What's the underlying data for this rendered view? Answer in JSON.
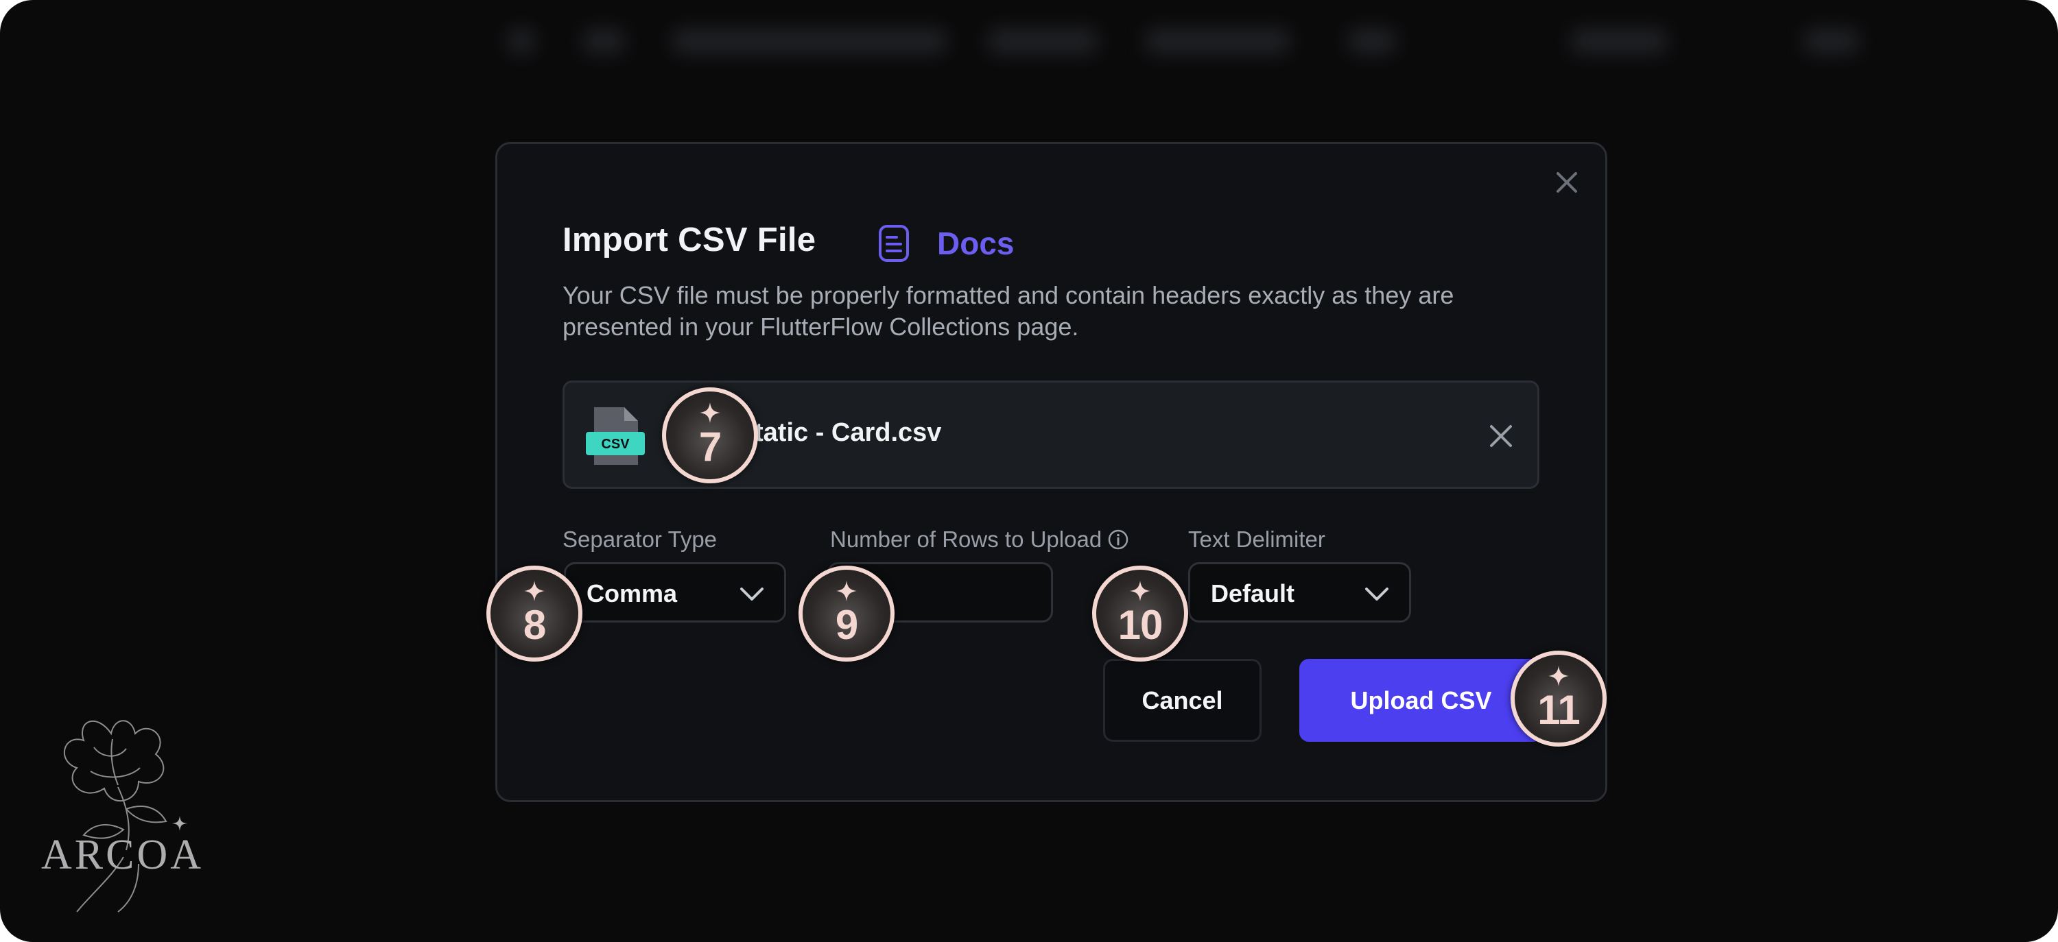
{
  "modal": {
    "title": "Import CSV File",
    "docs_label": "Docs",
    "description": "Your CSV file must be properly formatted and contain headers exactly as they are presented in your FlutterFlow Collections page.",
    "file": {
      "icon_label": "CSV",
      "name": "tatic - Card.csv"
    },
    "fields": {
      "separator_label": "Separator Type",
      "separator_value": "Comma",
      "rows_label": "Number of Rows to Upload",
      "rows_value": "",
      "delimiter_label": "Text Delimiter",
      "delimiter_value": "Default"
    },
    "buttons": {
      "cancel": "Cancel",
      "upload": "Upload CSV"
    }
  },
  "markers": [
    "7",
    "8",
    "9",
    "10",
    "11"
  ],
  "brand": {
    "name": "ARCOA"
  },
  "colors": {
    "background": "#0a0a0b",
    "modal": "#0f1114",
    "accent": "#4c3ff0",
    "docs_link": "#6d5ef2",
    "csv_badge": "#3ed6c0",
    "marker_ring": "#f4d7d0"
  },
  "icons": {
    "close": "close-icon",
    "docs": "document-icon",
    "file": "csv-file-icon",
    "remove": "close-icon",
    "info": "info-icon",
    "dropdown": "chevron-down-icon",
    "marker": "sparkle-icon"
  }
}
